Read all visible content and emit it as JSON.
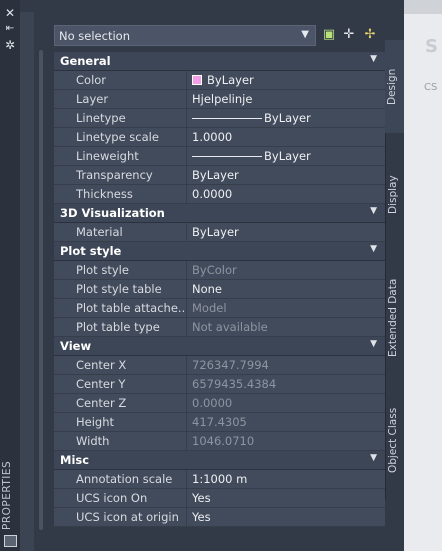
{
  "window": {
    "title": "PROPERTIES"
  },
  "selection": {
    "value": "No selection"
  },
  "tabs": [
    "Design",
    "Display",
    "Extended Data",
    "Object Class"
  ],
  "background": {
    "ghost_letter": "S",
    "ghost_text": "CS"
  },
  "categories": [
    {
      "label": "General",
      "rows": [
        {
          "name": "Color",
          "value": "ByLayer",
          "swatch": "#f2a0e8"
        },
        {
          "name": "Layer",
          "value": "Hjelpelinje"
        },
        {
          "name": "Linetype",
          "value": "ByLayer",
          "line": true
        },
        {
          "name": "Linetype scale",
          "value": "1.0000"
        },
        {
          "name": "Lineweight",
          "value": "ByLayer",
          "line": true
        },
        {
          "name": "Transparency",
          "value": "ByLayer"
        },
        {
          "name": "Thickness",
          "value": "0.0000"
        }
      ]
    },
    {
      "label": "3D Visualization",
      "rows": [
        {
          "name": "Material",
          "value": "ByLayer"
        }
      ]
    },
    {
      "label": "Plot style",
      "rows": [
        {
          "name": "Plot style",
          "value": "ByColor",
          "readonly": true
        },
        {
          "name": "Plot style table",
          "value": "None"
        },
        {
          "name": "Plot table attache...",
          "value": "Model",
          "readonly": true
        },
        {
          "name": "Plot table type",
          "value": "Not available",
          "readonly": true
        }
      ]
    },
    {
      "label": "View",
      "rows": [
        {
          "name": "Center X",
          "value": "726347.7994",
          "readonly": true
        },
        {
          "name": "Center Y",
          "value": "6579435.4384",
          "readonly": true
        },
        {
          "name": "Center Z",
          "value": "0.0000",
          "readonly": true
        },
        {
          "name": "Height",
          "value": "417.4305",
          "readonly": true
        },
        {
          "name": "Width",
          "value": "1046.0710",
          "readonly": true
        }
      ]
    },
    {
      "label": "Misc",
      "rows": [
        {
          "name": "Annotation scale",
          "value": "1:1000 m"
        },
        {
          "name": "UCS icon On",
          "value": "Yes"
        },
        {
          "name": "UCS icon at origin",
          "value": "Yes"
        }
      ]
    }
  ]
}
